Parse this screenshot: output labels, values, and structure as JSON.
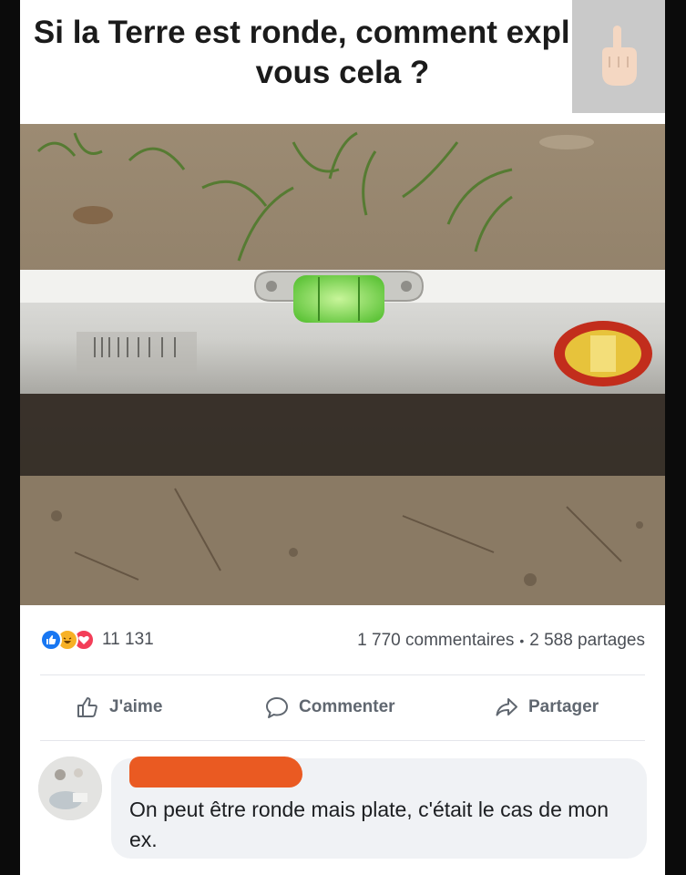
{
  "post": {
    "title": "Si la Terre est ronde, comment expliquez vous cela ?"
  },
  "stats": {
    "reactions_count": "11 131",
    "comments": "1 770 commentaires",
    "separator": "•",
    "shares": "2 588 partages",
    "reaction_icons": [
      "like-icon",
      "haha-icon",
      "love-icon"
    ]
  },
  "actions": {
    "like": "J'aime",
    "comment": "Commenter",
    "share": "Partager"
  },
  "comment": {
    "text": "On peut être ronde mais plate, c'était le cas de mon ex."
  },
  "colors": {
    "like_blue": "#1877f2",
    "haha_yellow": "#f7b125",
    "love_red": "#f33e58",
    "redaction_orange": "#ea5a22",
    "level_bubble_green": "#7ed957"
  }
}
